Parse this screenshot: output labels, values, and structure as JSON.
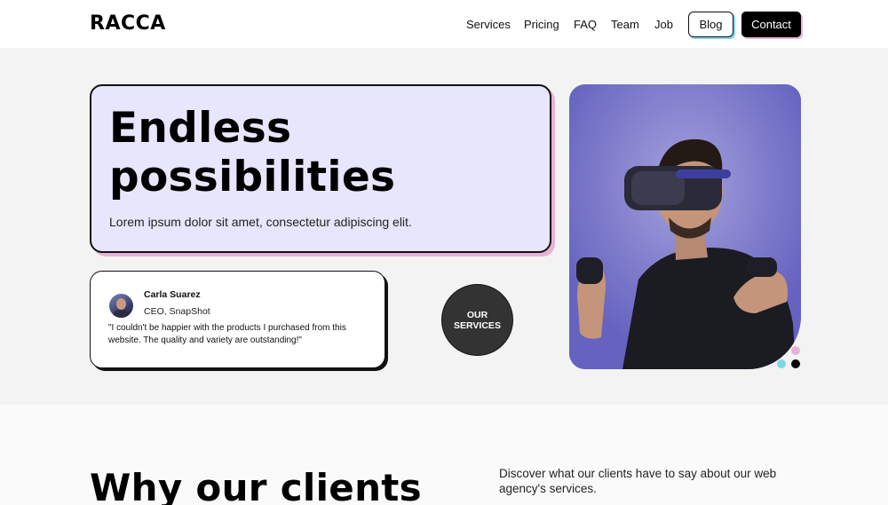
{
  "header": {
    "logo": "RACCA",
    "nav": [
      "Services",
      "Pricing",
      "FAQ",
      "Team",
      "Job"
    ],
    "blog_label": "Blog",
    "contact_label": "Contact"
  },
  "hero": {
    "headline_line1": "Endless",
    "headline_line2": "possibilities",
    "subtitle": "Lorem ipsum dolor sit amet, consectetur adipiscing elit.",
    "services_line1": "OUR",
    "services_line2": "SERVICES"
  },
  "testimonial": {
    "name": "Carla Suarez",
    "role": "CEO, SnapShot",
    "quote": "\"I couldn't be happier with the products I purchased from this website. The quality and variety are outstanding!\""
  },
  "section2": {
    "title": "Why our clients",
    "description": "Discover what our clients have to say about our web agency's services."
  },
  "colors": {
    "accent_lavender": "#e7e6fc",
    "accent_pink": "#e6b3d6",
    "accent_cyan": "#7fd6e6",
    "dark": "#000000"
  },
  "icons": [
    "avatar",
    "vr-photo",
    "carousel-dots"
  ]
}
